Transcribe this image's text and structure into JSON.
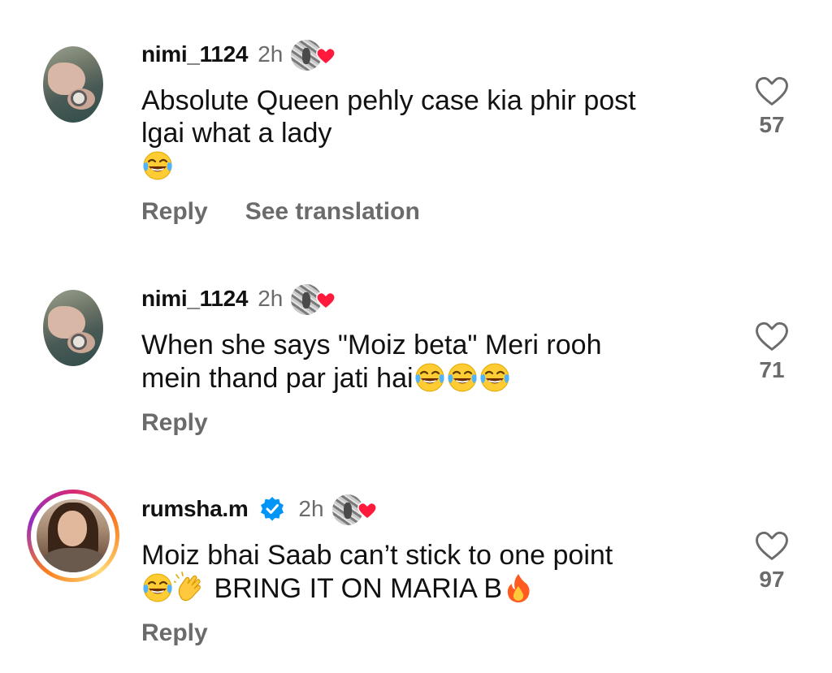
{
  "comments": [
    {
      "username": "nimi_1124",
      "time": "2h",
      "line1": "Absolute Queen pehly case kia phir post",
      "line2": "lgai what a lady",
      "emoji_count": 1,
      "likes": "57",
      "actions": [
        "Reply",
        "See translation"
      ]
    },
    {
      "username": "nimi_1124",
      "time": "2h",
      "line1": "When she says \"Moiz beta\" Meri rooh",
      "line2": "mein thand par jati hai",
      "likes": "71",
      "actions": [
        "Reply"
      ]
    },
    {
      "username": "rumsha.m",
      "verified": true,
      "time": "2h",
      "line1": "Moiz bhai Saab can’t stick to one point",
      "line2": "BRING IT ON MARIA B",
      "likes": "97",
      "actions": [
        "Reply"
      ]
    }
  ],
  "colors": {
    "text": "#111111",
    "muted": "#6b6b6b",
    "heart_red": "#ff1a3d",
    "verified_blue": "#0095f6"
  },
  "icons": {
    "like": "heart-outline-icon",
    "creator_like": "creator-liked-heart-icon",
    "emoji_laugh": "face-with-tears-of-joy",
    "emoji_clap": "clapping-hands",
    "emoji_fire": "fire"
  }
}
